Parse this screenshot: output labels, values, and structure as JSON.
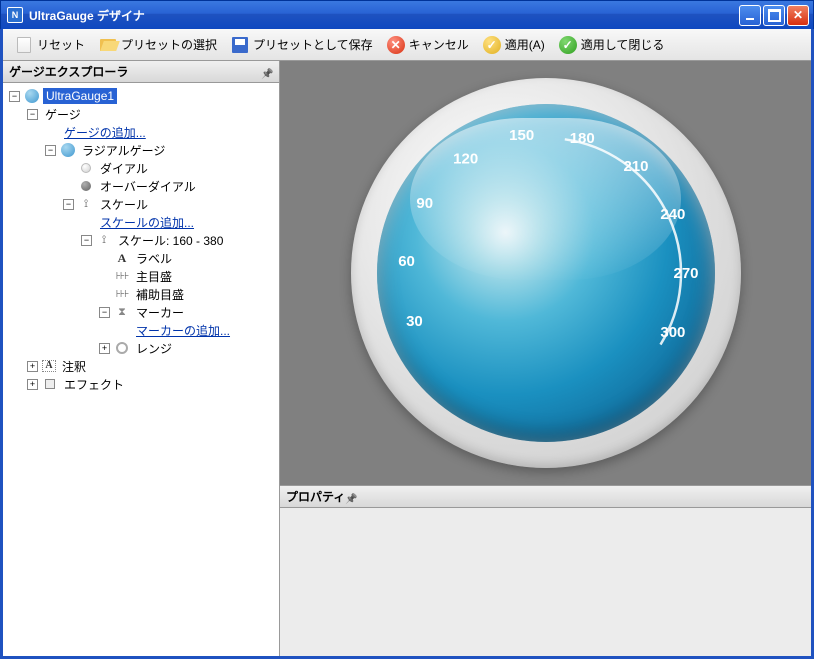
{
  "window": {
    "title": "UltraGauge デザイナ"
  },
  "toolbar": {
    "reset": "リセット",
    "preset_select": "プリセットの選択",
    "preset_save": "プリセットとして保存",
    "cancel_x": "✕",
    "cancel": "キャンセル",
    "apply_check": "✓",
    "apply": "適用(A)",
    "ok_check": "✓",
    "apply_close": "適用して閉じる"
  },
  "explorer": {
    "title": "ゲージエクスプローラ",
    "nodes": {
      "root": "UltraGauge1",
      "gauge": "ゲージ",
      "add_gauge": "ゲージの追加...",
      "radial": "ラジアルゲージ",
      "dial": "ダイアル",
      "overdial": "オーバーダイアル",
      "scale": "スケール",
      "add_scale": "スケールの追加...",
      "scale_range": "スケール: 160 - 380",
      "label": "ラベル",
      "major": "主目盛",
      "minor": "補助目盛",
      "marker": "マーカー",
      "add_marker": "マーカーの追加...",
      "range": "レンジ",
      "annotation": "注釈",
      "effect": "エフェクト"
    }
  },
  "properties": {
    "title": "プロパティ"
  },
  "chart_data": {
    "type": "gauge",
    "ticks": [
      {
        "value": 30,
        "angle": 160
      },
      {
        "value": 60,
        "angle": 185
      },
      {
        "value": 90,
        "angle": 210
      },
      {
        "value": 120,
        "angle": 235
      },
      {
        "value": 150,
        "angle": 260
      },
      {
        "value": 180,
        "angle": 285
      },
      {
        "value": 210,
        "angle": 310
      },
      {
        "value": 240,
        "angle": 335
      },
      {
        "value": 270,
        "angle": 360
      },
      {
        "value": 300,
        "angle": 385
      }
    ],
    "scale_start_angle": 160,
    "scale_end_angle": 380,
    "arc": {
      "start_angle": 278,
      "end_angle": 392,
      "radius": 135
    }
  }
}
